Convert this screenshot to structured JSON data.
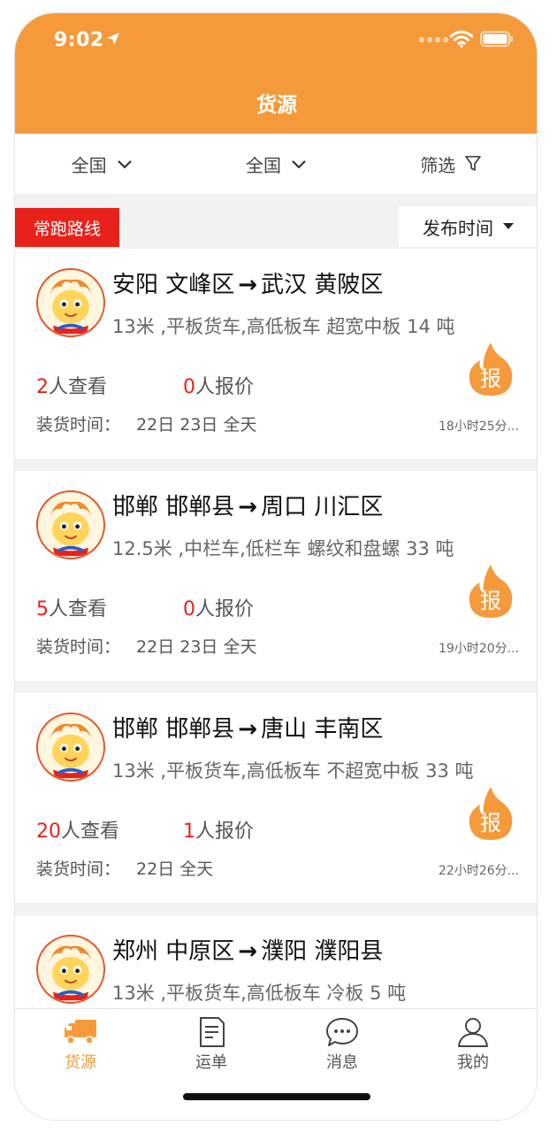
{
  "status_bar": {
    "time": "9:02"
  },
  "header": {
    "title": "货源"
  },
  "filters": [
    {
      "label": "全国",
      "icon": "chevron-down-icon"
    },
    {
      "label": "全国",
      "icon": "chevron-down-icon"
    },
    {
      "label": "筛选",
      "icon": "filter-icon"
    }
  ],
  "section": {
    "tag": "常跑路线",
    "sort_label": "发布时间"
  },
  "listings": [
    {
      "from": "安阳 文峰区",
      "to": "武汉 黄陂区",
      "spec": "13米 ,平板货车,高低板车 超宽中板 14 吨",
      "views": "2",
      "views_suffix": "人查看",
      "quotes": "0",
      "quotes_suffix": "人报价",
      "load_label": "装货时间：",
      "load_value": "22日 23日 全天",
      "ago": "18小时25分...",
      "quote_button": "报"
    },
    {
      "from": "邯郸 邯郸县",
      "to": "周口 川汇区",
      "spec": "12.5米 ,中栏车,低栏车 螺纹和盘螺 33 吨",
      "views": "5",
      "views_suffix": "人查看",
      "quotes": "0",
      "quotes_suffix": "人报价",
      "load_label": "装货时间：",
      "load_value": "22日 23日 全天",
      "ago": "19小时20分...",
      "quote_button": "报"
    },
    {
      "from": "邯郸 邯郸县",
      "to": "唐山 丰南区",
      "spec": "13米 ,平板货车,高低板车 不超宽中板 33 吨",
      "views": "20",
      "views_suffix": "人查看",
      "quotes": "1",
      "quotes_suffix": "人报价",
      "load_label": "装货时间：",
      "load_value": "22日 全天",
      "ago": "22小时26分...",
      "quote_button": "报"
    },
    {
      "from": "郑州 中原区",
      "to": "濮阳 濮阳县",
      "spec": "13米 ,平板货车,高低板车 冷板 5 吨",
      "views": "",
      "views_suffix": "",
      "quotes": "",
      "quotes_suffix": "",
      "load_label": "",
      "load_value": "",
      "ago": "",
      "quote_button": ""
    }
  ],
  "arrow": "→",
  "tabs": [
    {
      "label": "货源",
      "icon": "truck-icon",
      "active": true
    },
    {
      "label": "运单",
      "icon": "document-icon",
      "active": false
    },
    {
      "label": "消息",
      "icon": "chat-bubble-icon",
      "active": false
    },
    {
      "label": "我的",
      "icon": "person-icon",
      "active": false
    }
  ],
  "colors": {
    "brand": "#f59a3b",
    "accent_red": "#e8221a",
    "tab_active": "#f59a3b"
  }
}
